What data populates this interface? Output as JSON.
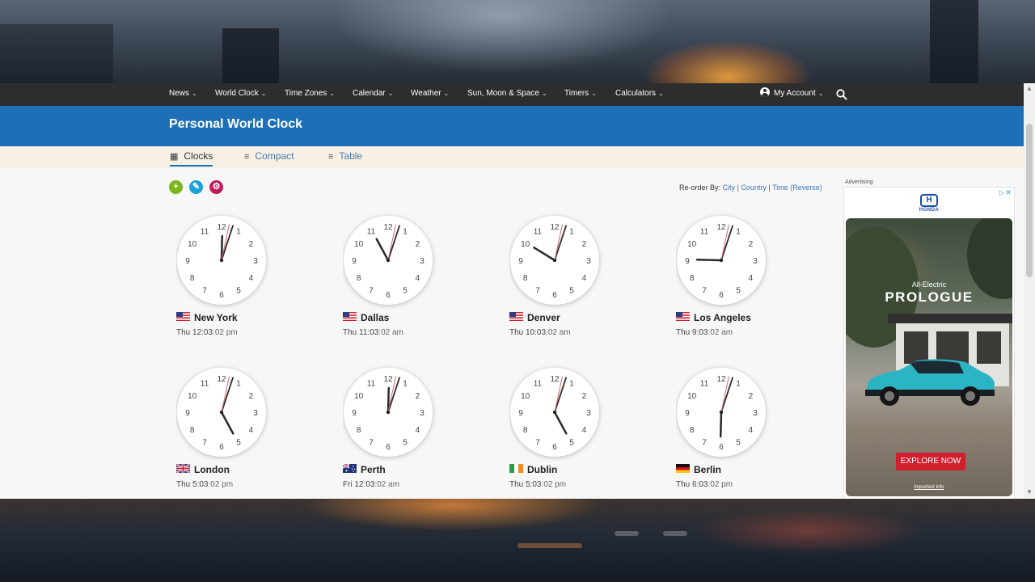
{
  "nav": {
    "items": [
      "News",
      "World Clock",
      "Time Zones",
      "Calendar",
      "Weather",
      "Sun, Moon & Space",
      "Timers",
      "Calculators"
    ],
    "account": "My Account"
  },
  "page_title": "Personal World Clock",
  "tabs": [
    {
      "label": "Clocks",
      "active": true
    },
    {
      "label": "Compact",
      "active": false
    },
    {
      "label": "Table",
      "active": false
    }
  ],
  "actions": [
    {
      "name": "add",
      "color": "#7cb518"
    },
    {
      "name": "edit",
      "color": "#1aa3d6"
    },
    {
      "name": "settings",
      "color": "#c0195e"
    }
  ],
  "reorder": {
    "label": "Re-order By:",
    "options": [
      "City",
      "Country",
      "Time (Reverse)"
    ]
  },
  "clocks": [
    {
      "city": "New York",
      "flag": "us",
      "time": "Thu 12:03",
      "sec": ":02 pm",
      "hour": 12,
      "minute": 3,
      "second": 2
    },
    {
      "city": "Dallas",
      "flag": "us",
      "time": "Thu 11:03",
      "sec": ":02 am",
      "hour": 11,
      "minute": 3,
      "second": 2
    },
    {
      "city": "Denver",
      "flag": "us",
      "time": "Thu 10:03",
      "sec": ":02 am",
      "hour": 10,
      "minute": 3,
      "second": 2
    },
    {
      "city": "Los Angeles",
      "flag": "us",
      "time": "Thu 9:03",
      "sec": ":02 am",
      "hour": 9,
      "minute": 3,
      "second": 2
    },
    {
      "city": "London",
      "flag": "gb",
      "time": "Thu 5:03",
      "sec": ":02 pm",
      "hour": 5,
      "minute": 3,
      "second": 2
    },
    {
      "city": "Perth",
      "flag": "au",
      "time": "Fri 12:03",
      "sec": ":02 am",
      "hour": 12,
      "minute": 3,
      "second": 2
    },
    {
      "city": "Dublin",
      "flag": "ie",
      "time": "Thu 5:03",
      "sec": ":02 pm",
      "hour": 5,
      "minute": 3,
      "second": 2
    },
    {
      "city": "Berlin",
      "flag": "de",
      "time": "Thu 6:03",
      "sec": ":02 pm",
      "hour": 6,
      "minute": 3,
      "second": 2
    }
  ],
  "ad": {
    "label": "Advertising",
    "brand": "HONDA",
    "logo": "H",
    "subheadline": "All-Electric",
    "headline": "PROLOGUE",
    "cta": "EXPLORE NOW",
    "info": "Important Info",
    "badge_icon": "adchoices-icon"
  },
  "colors": {
    "nav_bg": "#2d2d2d",
    "title_bg": "#1d70b7",
    "tab_bg": "#f6f1e4",
    "link": "#3b74b8"
  }
}
